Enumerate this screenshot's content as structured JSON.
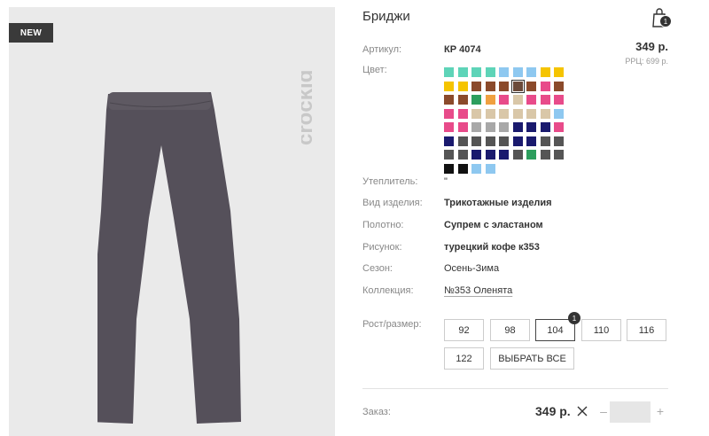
{
  "product": {
    "badge": "NEW",
    "brand_logo": "crockid",
    "title": "Бриджи",
    "cart_count": "1",
    "article_label": "Артикул:",
    "article_value": "КР 4074",
    "price": "349 р.",
    "rrp": "РРЦ: 699 р.",
    "color_label": "Цвет:",
    "colors": [
      "#5ed4b8",
      "#5ed4b8",
      "#5ed4b8",
      "#5ed4b8",
      "#8ec8f0",
      "#8ec8f0",
      "#8ec8f0",
      "#f5c400",
      "#f5c400",
      "#f5c400",
      "#f5c400",
      "#8b4a2b",
      "#8b4a2b",
      "#8b4a2b",
      "#6b4a3a",
      "#8b4a2b",
      "#e84b8a",
      "#8b4a2b",
      "#8b4a2b",
      "#8b4a2b",
      "#2d9e5e",
      "#f0a040",
      "#e84b8a",
      "#d9c7a8",
      "#e84b8a",
      "#e84b8a",
      "#e84b8a",
      "#e84b8a",
      "#e84b8a",
      "#d9c7a8",
      "#d9c7a8",
      "#d9c7a8",
      "#d9c7a8",
      "#d9c7a8",
      "#d9c7a8",
      "#8ec8f0",
      "#e84b8a",
      "#e84b8a",
      "#a8a8a8",
      "#a8a8a8",
      "#a8a8a8",
      "#1a1a6e",
      "#1a1a6e",
      "#1a1a6e",
      "#e84b8a",
      "#1a1a6e",
      "#555555",
      "#555555",
      "#555555",
      "#555555",
      "#1a1a6e",
      "#1a1a6e",
      "#555555",
      "#555555",
      "#555555",
      "#555555",
      "#1a1a6e",
      "#1a1a6e",
      "#1a1a6e",
      "#555555",
      "#2d9e5e",
      "#555555",
      "#555555",
      "#111111",
      "#111111",
      "#8ec8f0",
      "#8ec8f0"
    ],
    "selected_color_index": 14,
    "specs": [
      {
        "label": "Утеплитель:",
        "value": "\"",
        "bold": false
      },
      {
        "label": "Вид изделия:",
        "value": "Трикотажные изделия",
        "bold": true
      },
      {
        "label": "Полотно:",
        "value": "Супрем с эластаном",
        "bold": true
      },
      {
        "label": "Рисунок:",
        "value": "турецкий кофе к353",
        "bold": true
      },
      {
        "label": "Сезон:",
        "value": "Осень-Зима",
        "bold": false
      },
      {
        "label": "Коллекция:",
        "value": "№353 Оленята",
        "bold": false
      }
    ],
    "size_label": "Рост/размер:",
    "sizes": [
      "92",
      "98",
      "104",
      "110",
      "116",
      "122"
    ],
    "selected_size": "104",
    "selected_size_count": "1",
    "select_all_label": "ВЫБРАТЬ ВСЕ",
    "order_label": "Заказ:",
    "order_price": "349 р.",
    "qty_minus": "–",
    "qty_plus": "+",
    "qty_value": ""
  }
}
